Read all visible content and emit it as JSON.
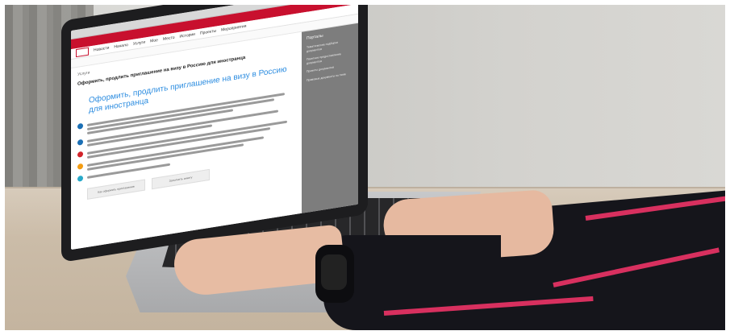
{
  "screen": {
    "nav_items": [
      "Новости",
      "Начало",
      "Услуги",
      "Мое",
      "Место",
      "Истории",
      "Проекты",
      "Мероприятия"
    ],
    "section": "Услуги",
    "page_title": "Оформить, продлить приглашение на визу в Россию для иностранца",
    "heading": "Оформить, продлить приглашение на визу в Россию для иностранца",
    "side_title": "Порталы",
    "side_items": [
      "Тематические подборки документов",
      "Пакетное предоставление документов",
      "Проекты документов",
      "Правовые документы по теме"
    ],
    "buttons": [
      "Как оформить приглашение",
      "Заполнить анкету"
    ]
  },
  "colors": {
    "brand_red": "#c8102e",
    "link_blue": "#2d8de0",
    "sleeve_stripe": "#d8305f"
  }
}
